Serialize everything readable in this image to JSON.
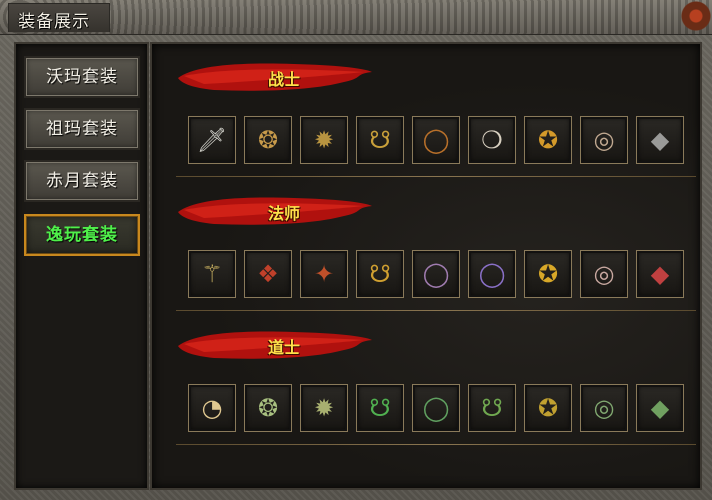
{
  "window": {
    "title": "装备展示"
  },
  "sidebar": {
    "tabs": [
      {
        "label": "沃玛套装",
        "active": false
      },
      {
        "label": "祖玛套装",
        "active": false
      },
      {
        "label": "赤月套装",
        "active": false
      },
      {
        "label": "逸玩套装",
        "active": true
      }
    ]
  },
  "sections": [
    {
      "title": "战士",
      "items": [
        {
          "icon": "sword-icon",
          "glyph": "🗡",
          "color": "#cfcfc8"
        },
        {
          "icon": "armor-icon",
          "glyph": "❂",
          "color": "#c79a4a"
        },
        {
          "icon": "helmet-icon",
          "glyph": "✹",
          "color": "#b89440"
        },
        {
          "icon": "necklace-icon",
          "glyph": "☋",
          "color": "#c9a03a"
        },
        {
          "icon": "bracelet-icon",
          "glyph": "◯",
          "color": "#b8702a"
        },
        {
          "icon": "necklace-beads-icon",
          "glyph": "❍",
          "color": "#d8d0c0"
        },
        {
          "icon": "medal-icon",
          "glyph": "✪",
          "color": "#d49a2a"
        },
        {
          "icon": "ring-icon",
          "glyph": "◎",
          "color": "#c0a890"
        },
        {
          "icon": "boots-icon",
          "glyph": "◆",
          "color": "#9a9a98"
        }
      ]
    },
    {
      "title": "法师",
      "items": [
        {
          "icon": "staff-icon",
          "glyph": "⚚",
          "color": "#c8b060"
        },
        {
          "icon": "robe-icon",
          "glyph": "❖",
          "color": "#c0402a"
        },
        {
          "icon": "helmet-icon",
          "glyph": "✦",
          "color": "#c0502a"
        },
        {
          "icon": "necklace-icon",
          "glyph": "☋",
          "color": "#d0a030"
        },
        {
          "icon": "bracelet-icon",
          "glyph": "◯",
          "color": "#a07cb0"
        },
        {
          "icon": "bracelet-icon",
          "glyph": "◯",
          "color": "#8a70c8"
        },
        {
          "icon": "medal-icon",
          "glyph": "✪",
          "color": "#d8a828"
        },
        {
          "icon": "ring-icon",
          "glyph": "◎",
          "color": "#c8a8a0"
        },
        {
          "icon": "boots-icon",
          "glyph": "◆",
          "color": "#c04040"
        }
      ]
    },
    {
      "title": "道士",
      "items": [
        {
          "icon": "fan-icon",
          "glyph": "◔",
          "color": "#e0c890"
        },
        {
          "icon": "armor-icon",
          "glyph": "❂",
          "color": "#a8c080"
        },
        {
          "icon": "helmet-icon",
          "glyph": "✹",
          "color": "#a8b070"
        },
        {
          "icon": "necklace-icon",
          "glyph": "☋",
          "color": "#50b050"
        },
        {
          "icon": "bracelet-icon",
          "glyph": "◯",
          "color": "#60a060"
        },
        {
          "icon": "necklace-icon",
          "glyph": "☋",
          "color": "#70a850"
        },
        {
          "icon": "medal-icon",
          "glyph": "✪",
          "color": "#c0a030"
        },
        {
          "icon": "ring-icon",
          "glyph": "◎",
          "color": "#80a870"
        },
        {
          "icon": "boots-icon",
          "glyph": "◆",
          "color": "#70a060"
        }
      ]
    }
  ]
}
